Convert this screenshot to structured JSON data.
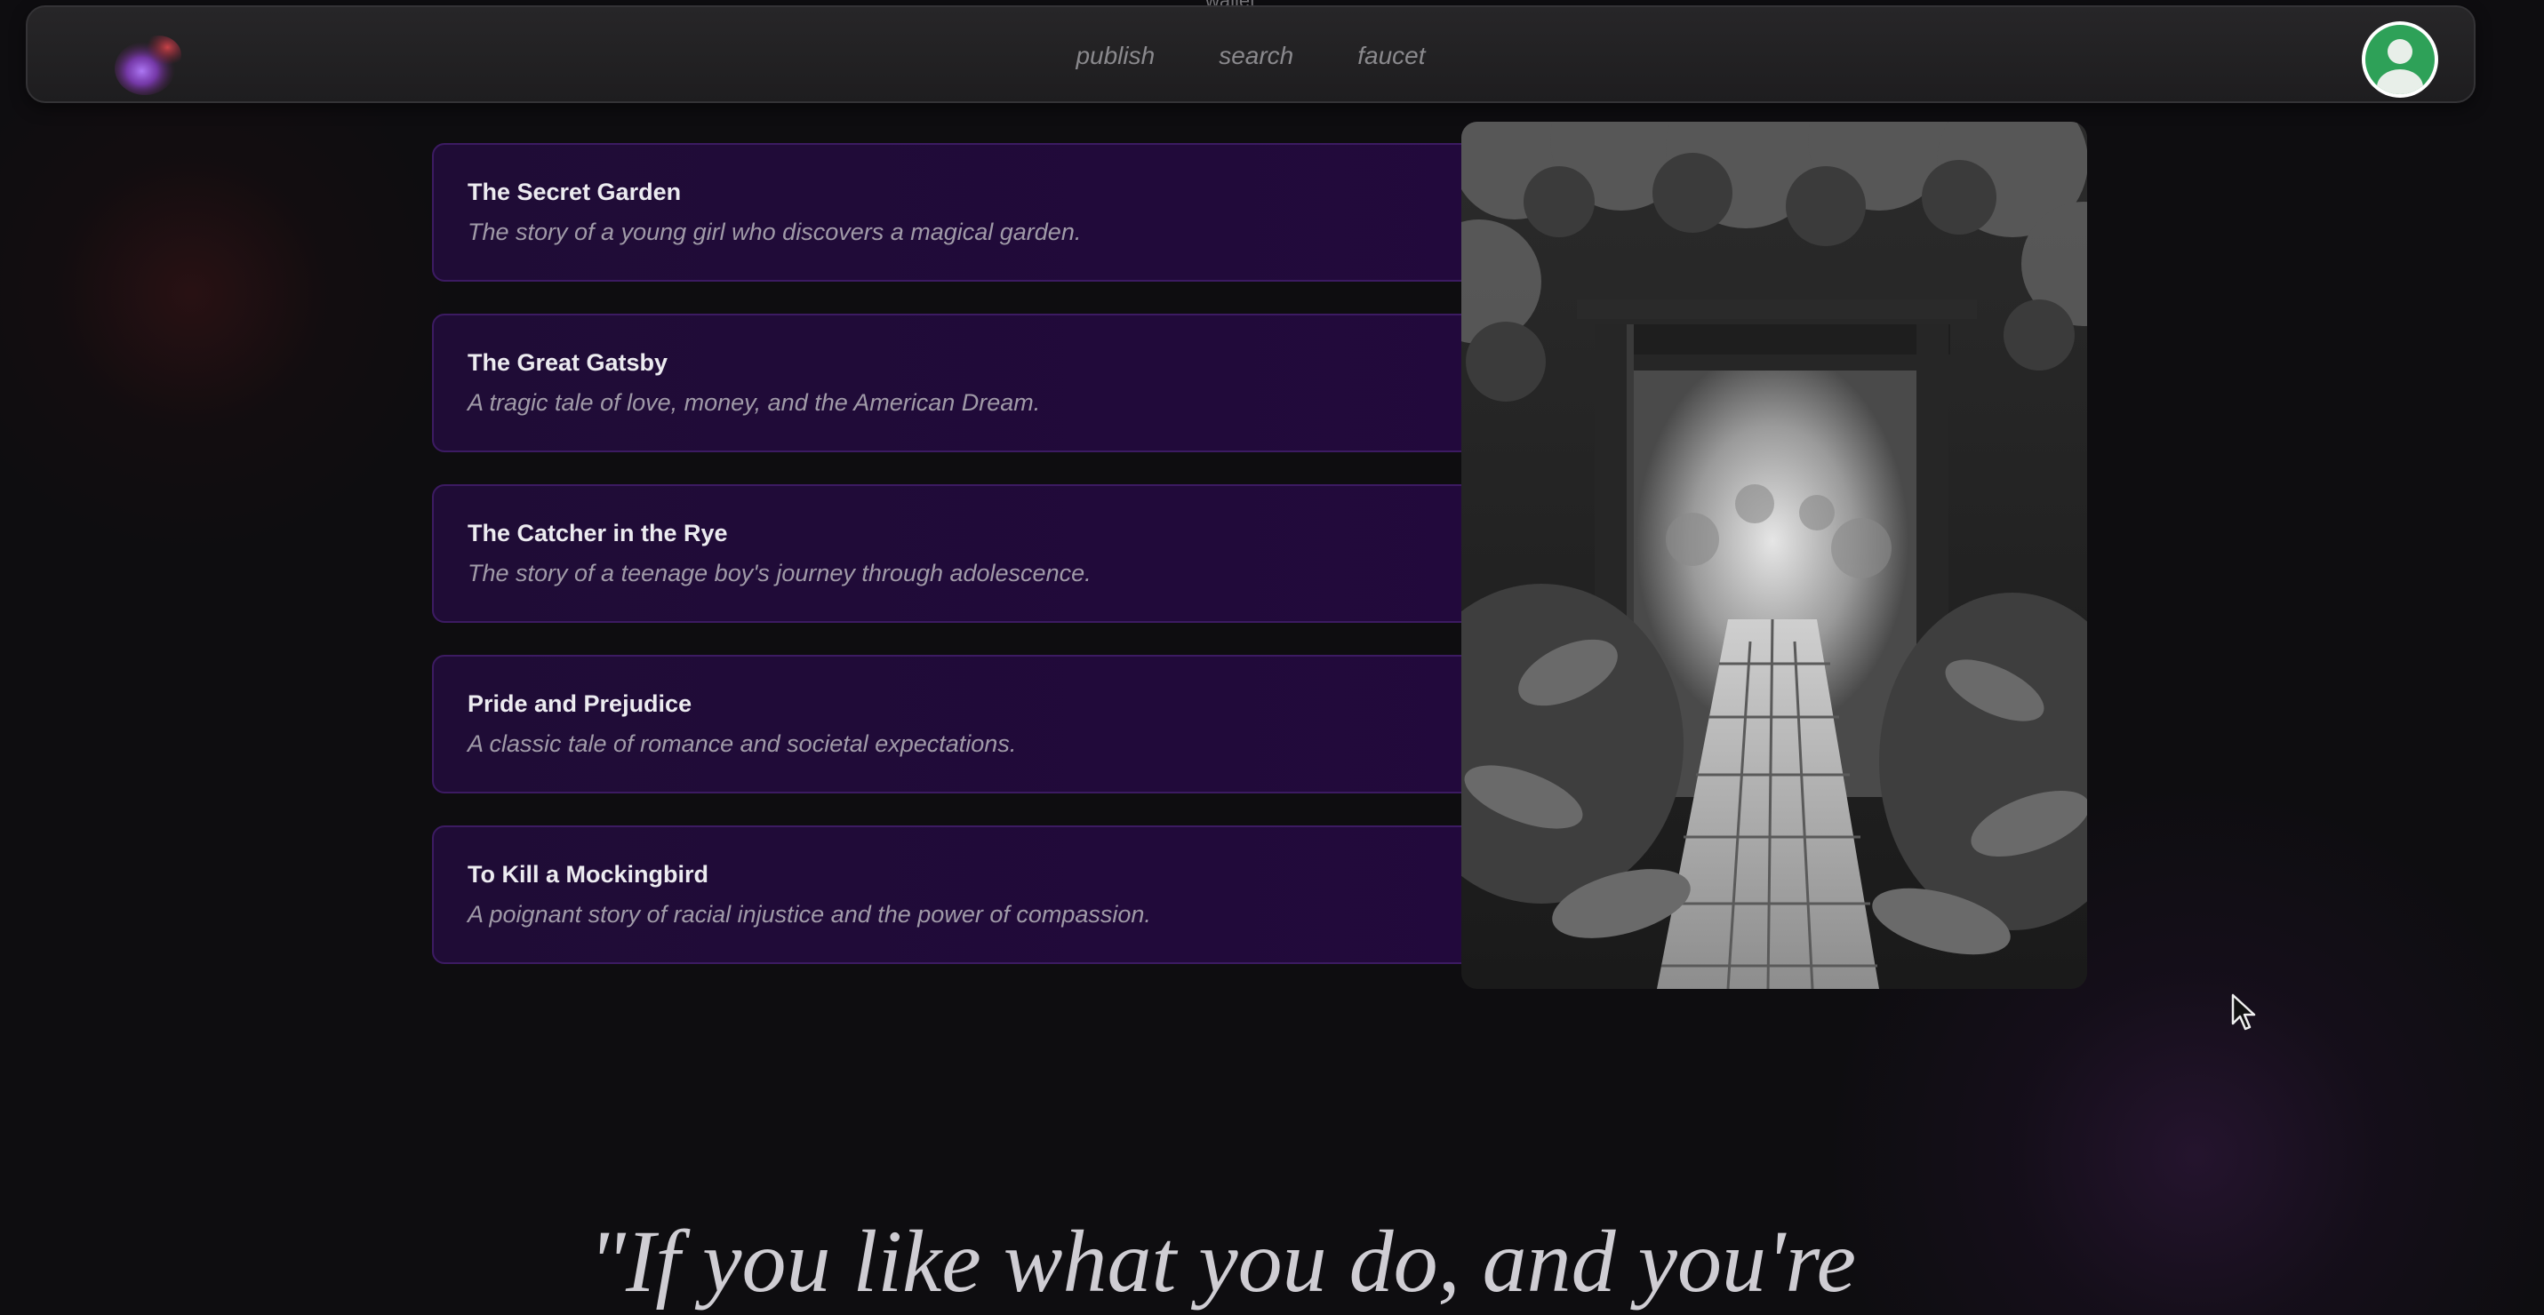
{
  "nav": {
    "links": [
      "publish",
      "search",
      "faucet"
    ],
    "top_hint": "wallet"
  },
  "books": [
    {
      "title": "The Secret Garden",
      "description": "The story of a young girl who discovers a magical garden."
    },
    {
      "title": "The Great Gatsby",
      "description": "A tragic tale of love, money, and the American Dream."
    },
    {
      "title": "The Catcher in the Rye",
      "description": "The story of a teenage boy's journey through adolescence."
    },
    {
      "title": "Pride and Prejudice",
      "description": "A classic tale of romance and societal expectations."
    },
    {
      "title": "To Kill a Mockingbird",
      "description": "A poignant story of racial injustice and the power of compassion."
    }
  ],
  "quote": {
    "text": "\"If you like what you do, and you're"
  },
  "colors": {
    "card_bg": "#22093c",
    "card_border": "#3c1b62",
    "avatar_green": "#2ea158",
    "page_bg": "#0e0d10"
  },
  "icons": {
    "logo": "gradient-orb-logo",
    "avatar": "user-avatar-icon",
    "cursor": "mouse-pointer-icon"
  }
}
